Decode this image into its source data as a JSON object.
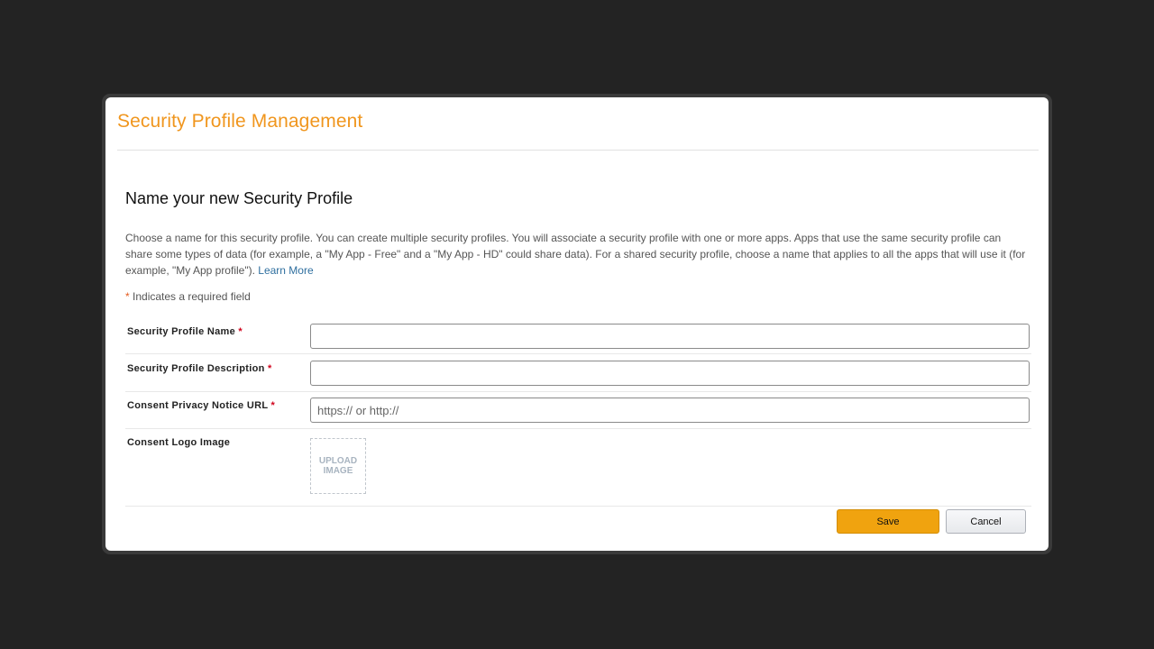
{
  "header": {
    "title": "Security Profile Management"
  },
  "section": {
    "heading": "Name your new Security Profile",
    "description": "Choose a name for this security profile. You can create multiple security profiles. You will associate a security profile with one or more apps. Apps that use the same security profile can share some types of data (for example, a \"My App - Free\" and a \"My App - HD\" could share data). For a shared security profile, choose a name that applies to all the apps that will use it (for example, \"My App profile\").",
    "learn_more": "Learn More",
    "required_marker": "*",
    "required_note": "Indicates a required field"
  },
  "form": {
    "profile_name": {
      "label": "Security Profile Name",
      "required": "*",
      "value": "",
      "placeholder": ""
    },
    "profile_description": {
      "label": "Security Profile Description",
      "required": "*",
      "value": "",
      "placeholder": ""
    },
    "privacy_url": {
      "label": "Consent Privacy Notice URL",
      "required": "*",
      "value": "",
      "placeholder": "https:// or http://"
    },
    "logo_image": {
      "label": "Consent Logo Image",
      "upload_line1": "UPLOAD",
      "upload_line2": "IMAGE"
    }
  },
  "actions": {
    "save_label": "Save",
    "cancel_label": "Cancel"
  },
  "colors": {
    "title": "#f0961e",
    "save_button": "#f0a30f",
    "link": "#2f6f9f",
    "required": "#d0021b"
  }
}
